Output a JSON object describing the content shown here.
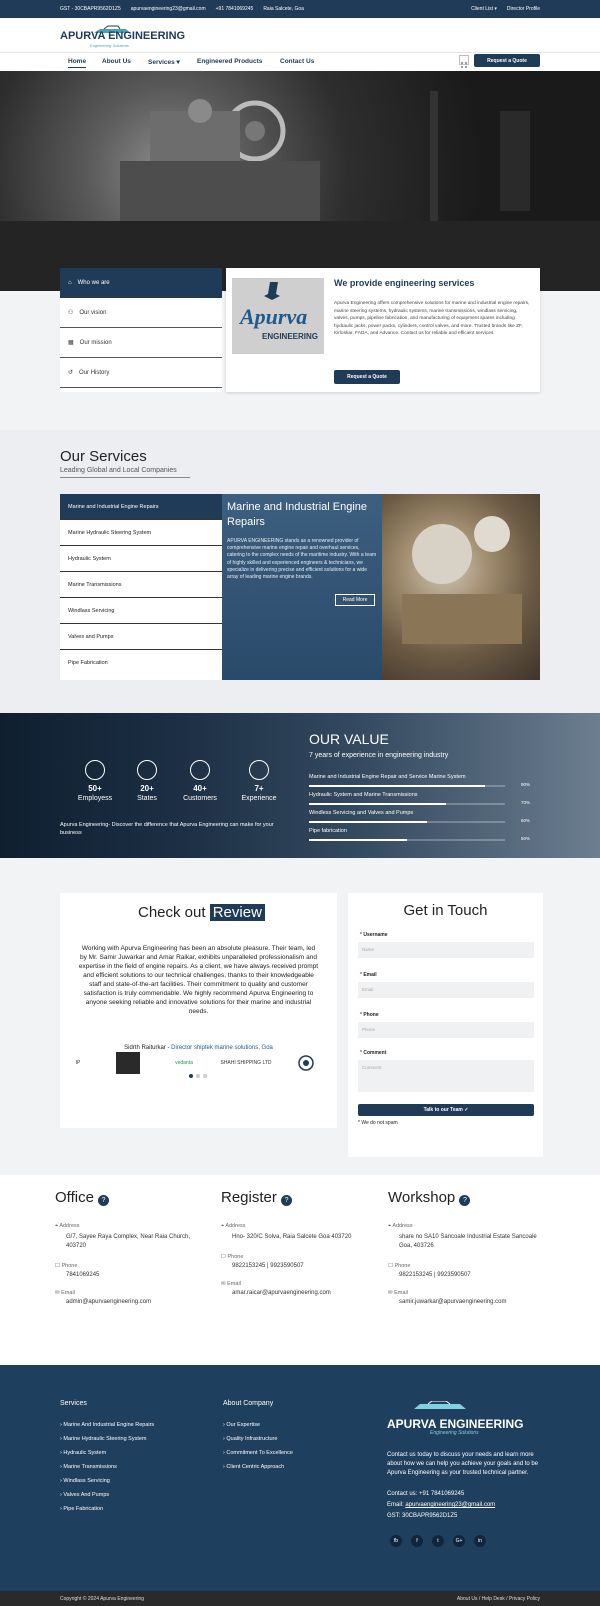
{
  "topbar": {
    "gst": "GST - 30CBAPR9562D1Z5",
    "email": "apurvaengineering23@gmail.com",
    "phone": "+91 7841069245",
    "location": "Raia Salcete, Goa",
    "client_list": "Client List ▾",
    "director_profile": "Director Profile"
  },
  "brand": {
    "name": "APURVA ENGINEERING",
    "tagline": "Engineering Solutions"
  },
  "nav": {
    "items": [
      "Home",
      "About Us",
      "Services ▾",
      "Engineered Products",
      "Contact Us"
    ],
    "quote_button": "Request a Quote"
  },
  "about_tabs": {
    "items": [
      "Who we are",
      "Our vision",
      "Our mission",
      "Our History"
    ]
  },
  "intro": {
    "logo_text": "Apurva",
    "logo_sub": "ENGINEERING",
    "title": "We provide engineering services",
    "body": "Apurva Engineering offers comprehensive solutions for marine and industrial engine repairs, marine steering systems, hydraulic systems, marine transmissions, windlass servicing, valves, pumps, pipeline fabrication, and manufacturing of equipment spares including hydraulic jacks, power packs, cylinders, control valves, and more. Trusted brands like ZF, Kirloskar, FADA, and Advance. Contact us for reliable and efficient services.",
    "button": "Request a Quote"
  },
  "services": {
    "title": "Our Services",
    "subtitle": "Leading Global and Local Companies",
    "items": [
      "Marine and Industrial Engine Repairs",
      "Marine Hydraulic Steering System",
      "Hydraulic System",
      "Marine Transmissions",
      "Windlass Servicing",
      "Valves and Pumps",
      "Pipe Fabrication"
    ],
    "panel_title": "Marine and Industrial Engine Repairs",
    "panel_body": "APURVA ENGINEERING stands as a renowned provider of comprehensive marine engine repair and overhaul services, catering to the complex needs of the maritime industry. With a team of highly skilled and experienced engineers & technicians, we specialize in delivering precise and efficient solutions for a wide array of leading marine engine brands.",
    "read_more": "Read More"
  },
  "value": {
    "title": "OUR VALUE",
    "subtitle": "7 years of experience in engineering industry",
    "stats": [
      {
        "num": "50+",
        "label": "Employess"
      },
      {
        "num": "20+",
        "label": "States"
      },
      {
        "num": "40+",
        "label": "Customers"
      },
      {
        "num": "7+",
        "label": "Experience"
      }
    ],
    "tagline": "Apurva Engineering- Discover the difference that Apurva Engineering can make for your business",
    "bars": [
      {
        "label": "Marine and Industrial Engine Repair and Service Marine System",
        "pct": "90%",
        "fill": 0.9
      },
      {
        "label": "Hydraulic System and Marine Transmissions",
        "pct": "70%",
        "fill": 0.7
      },
      {
        "label": "Windless Servicing and Valves and Pumps",
        "pct": "60%",
        "fill": 0.6
      },
      {
        "label": "Pipe fabrication",
        "pct": "50%",
        "fill": 0.5
      }
    ]
  },
  "review": {
    "title_a": "Check out",
    "title_b": "Review",
    "body": "Working with Apurva Engineering has been an absolute pleasure. Their team, led by Mr. Samir Juwarkar and Amar Raikar, exhibits unparalleled professionalism and expertise in the field of engine repairs. As a client, we have always received prompt and efficient solutions to our technical challenges, thanks to their knowledgeable staff and state-of-the-art facilities. Their commitment to quality and customer satisfaction is truly commendable. We highly recommend Apurva Engineering to anyone seeking reliable and innovative solutions for their marine and industrial needs.",
    "author": "Sidrth Raiturkar -",
    "author_role": "Director shiptek marine solutions, Goa",
    "logos": [
      "IP",
      "",
      "vedanta",
      "SHAHI SHIPPING LTD",
      ""
    ]
  },
  "contact": {
    "title": "Get in Touch",
    "fields": [
      {
        "label": "Username",
        "placeholder": "Name"
      },
      {
        "label": "Email",
        "placeholder": "Email"
      },
      {
        "label": "Phone",
        "placeholder": "Phone"
      },
      {
        "label": "Comment",
        "placeholder": "Comment"
      }
    ],
    "button": "Talk to our Team ✓",
    "note": "* We do not spam"
  },
  "offices": [
    {
      "title": "Office",
      "address_label": "Address",
      "address": "G/7, Sayee Raya Complex, Near Raia Church, 403720",
      "phone_label": "Phone",
      "phone": "7841069245",
      "email_label": "Email",
      "email": "admin@apurvaengineering.com"
    },
    {
      "title": "Register",
      "address_label": "Address",
      "address": "Hno- 320/C Solva, Raia Salcete Goa 403720",
      "phone_label": "Phone",
      "phone": "9822153245 | 9923590507",
      "email_label": "Email",
      "email": "amar.raicar@apurvaengineering.com"
    },
    {
      "title": "Workshop",
      "address_label": "Address",
      "address": "share no SA10 Sancoale Industrial Estate Sancoale Goa, 403726",
      "phone_label": "Phone",
      "phone": "9822153245 | 9923590507",
      "email_label": "Email",
      "email": "samir.juwarkar@apurvaengineering.com"
    }
  ],
  "footer": {
    "services_title": "Services",
    "services": [
      "Marine And Industrial Engine Repairs",
      "Marine Hydraulic Steering System",
      "Hydraulic System",
      "Marine Transmissions",
      "Windlass Servicing",
      "Valves And Pumps",
      "Pipe Fabrication"
    ],
    "about_title": "About Company",
    "about": [
      "Our Expertise",
      "Quality Infrastructure",
      "Commitment To Excellence",
      "Client Centric Approach"
    ],
    "brand": "APURVA ENGINEERING",
    "brand_tag": "Engineering Solutions",
    "blurb": "Contact us today to discuss your needs and learn more about how we can help you achieve your goals and to be Apurva Engineering as your trusted technical partner.",
    "contact_phone": "Contact us: +91 7841069245",
    "contact_email_label": "Email:",
    "contact_email": "apurvaengineering23@gmail.com",
    "gst": "GST: 30CBAPR9562D1Z5",
    "social": [
      "fb",
      "f",
      "t",
      "G+",
      "in"
    ]
  },
  "copyright": {
    "left": "Copyright © 2024 Apurva Engineering",
    "right": "About Us / Help Desk / Privacy Policy"
  },
  "colors": {
    "primary": "#1f3b57",
    "accent": "#4aa3b5",
    "footer": "#1f3f5e"
  }
}
